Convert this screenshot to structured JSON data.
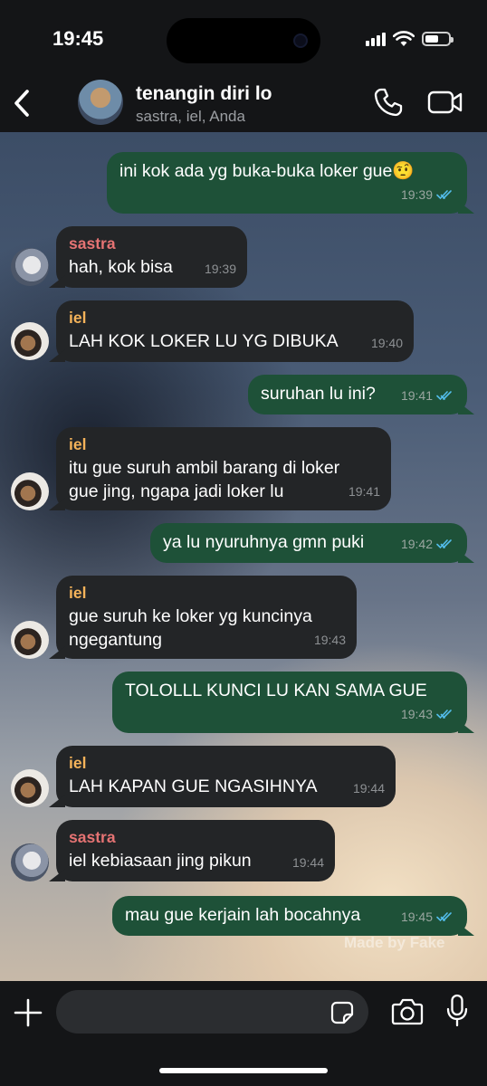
{
  "status_bar": {
    "time": "19:45"
  },
  "header": {
    "back_icon": "chevron-left-icon",
    "group_name": "tenangin diri lo",
    "members": "sastra, iel, Anda",
    "call_icon": "phone-icon",
    "video_icon": "video-camera-icon"
  },
  "messages": [
    {
      "direction": "out",
      "text": "ini kok ada yg buka-buka loker gue🤨",
      "time": "19:39",
      "status": "read"
    },
    {
      "direction": "in",
      "sender": "sastra",
      "text": "hah, kok bisa",
      "time": "19:39"
    },
    {
      "direction": "in",
      "sender": "iel",
      "text": "LAH KOK LOKER LU YG DIBUKA",
      "time": "19:40"
    },
    {
      "direction": "out",
      "text": "suruhan lu ini?",
      "time": "19:41",
      "status": "read"
    },
    {
      "direction": "in",
      "sender": "iel",
      "text": "itu gue suruh ambil barang di loker\ngue jing, ngapa jadi loker lu",
      "time": "19:41"
    },
    {
      "direction": "out",
      "text": "ya lu nyuruhnya gmn puki",
      "time": "19:42",
      "status": "read"
    },
    {
      "direction": "in",
      "sender": "iel",
      "text": "gue suruh ke loker yg kuncinya\nngegantung",
      "time": "19:43"
    },
    {
      "direction": "out",
      "text": "TOLOLLL KUNCI LU KAN SAMA GUE",
      "time": "19:43",
      "status": "read"
    },
    {
      "direction": "in",
      "sender": "iel",
      "text": "LAH KAPAN GUE NGASIHNYA",
      "time": "19:44"
    },
    {
      "direction": "in",
      "sender": "sastra",
      "text": "iel kebiasaan jing pikun",
      "time": "19:44"
    },
    {
      "direction": "out",
      "text": "mau gue kerjain lah bocahnya",
      "time": "19:45",
      "status": "read"
    }
  ],
  "watermark": "Made by Fake",
  "composer": {
    "placeholder": "",
    "plus_icon": "plus-icon",
    "sticker_icon": "sticker-icon",
    "camera_icon": "camera-icon",
    "mic_icon": "microphone-icon"
  },
  "colors": {
    "outgoing_bubble": "#1e5138",
    "incoming_bubble": "#232527",
    "read_ticks": "#53bdeb",
    "sastra_name": "#e57373",
    "iel_name": "#f4b35a"
  }
}
